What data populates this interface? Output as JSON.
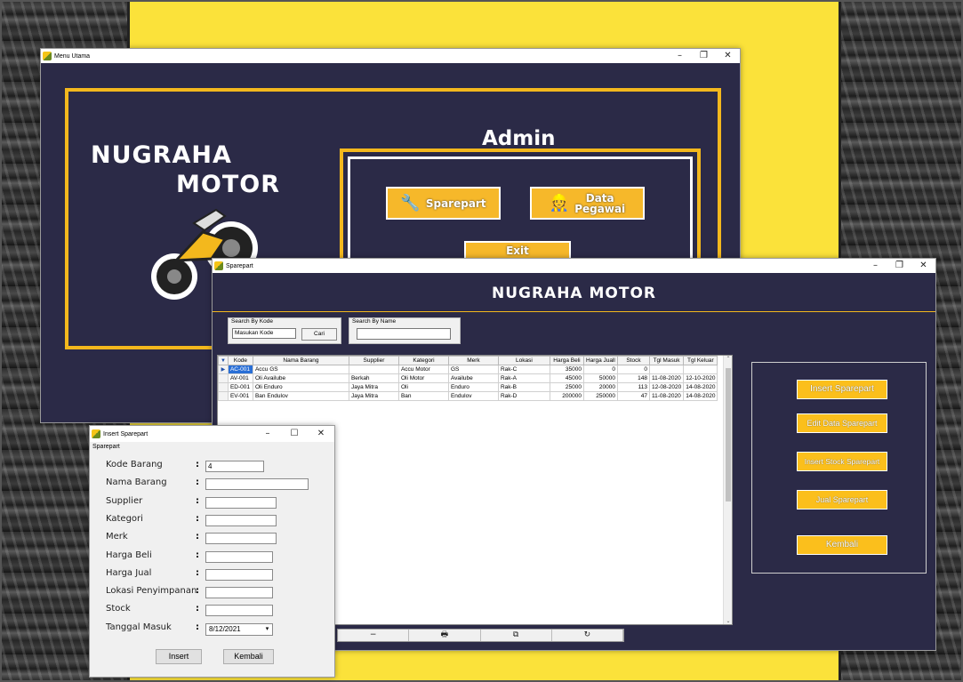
{
  "menu_window": {
    "title": "Menu Utama",
    "brand_line1": "NUGRAHA",
    "brand_line2": "MOTOR",
    "admin_title": "Admin",
    "btn_sparepart": "Sparepart",
    "btn_pegawai_line1": "Data",
    "btn_pegawai_line2": "Pegawai",
    "btn_exit": "Exit"
  },
  "sparepart_window": {
    "title": "Sparepart",
    "header": "NUGRAHA  MOTOR",
    "search_kode": {
      "label": "Search By Kode",
      "placeholder": "Masukan Kode",
      "button": "Cari"
    },
    "search_name": {
      "label": "Search By Name",
      "value": ""
    },
    "columns": [
      "Kode",
      "Nama Barang",
      "Supplier",
      "Kategori",
      "Merk",
      "Lokasi",
      "Harga Beli",
      "Harga Juall",
      "Stock",
      "Tgl Masuk",
      "Tgl Keluar"
    ],
    "rows": [
      [
        "AC-001",
        "Accu GS",
        "",
        "Accu Motor",
        "GS",
        "Rak-C",
        "35000",
        "0",
        "0",
        "",
        ""
      ],
      [
        "AV-001",
        "Oli Availube",
        "Berkah",
        "Oli Motor",
        "Availube",
        "Rak-A",
        "45000",
        "50000",
        "148",
        "11-08-2020",
        "12-10-2020"
      ],
      [
        "ED-001",
        "Oli Enduro",
        "Jaya Mitra",
        "Oli",
        "Enduro",
        "Rak-B",
        "25000",
        "20000",
        "113",
        "12-08-2020",
        "14-08-2020"
      ],
      [
        "EV-001",
        "Ban Endulov",
        "Jaya Mitra",
        "Ban",
        "Endulov",
        "Rak-D",
        "200000",
        "250000",
        "47",
        "11-08-2020",
        "14-08-2020"
      ]
    ],
    "actions": {
      "insert": "Insert Sparepart",
      "edit": "Edit Data Sparepart",
      "insert_stock": "Insert Stock Sparepart",
      "jual": "Jual Sparepart",
      "kembali": "Kembali"
    },
    "navbar": [
      "−",
      "🖶",
      "⧉",
      "↻"
    ]
  },
  "insert_window": {
    "title": "Insert Sparepart",
    "group": "Sparepart",
    "fields": [
      {
        "label": "Kode Barang",
        "value": "4"
      },
      {
        "label": "Nama Barang",
        "value": ""
      },
      {
        "label": "Supplier",
        "value": ""
      },
      {
        "label": "Kategori",
        "value": ""
      },
      {
        "label": "Merk",
        "value": ""
      },
      {
        "label": "Harga Beli",
        "value": ""
      },
      {
        "label": "Harga Jual",
        "value": ""
      },
      {
        "label": "Lokasi Penyimpanan",
        "value": ""
      },
      {
        "label": "Stock",
        "value": ""
      },
      {
        "label": "Tanggal Masuk",
        "value": "8/12/2021"
      }
    ],
    "btn_insert": "Insert",
    "btn_kembali": "Kembali"
  },
  "colors": {
    "navy": "#2b2a47",
    "gold": "#f3b81d",
    "button_yellow": "#fbbf1c",
    "background_yellow": "#fbe23a"
  }
}
